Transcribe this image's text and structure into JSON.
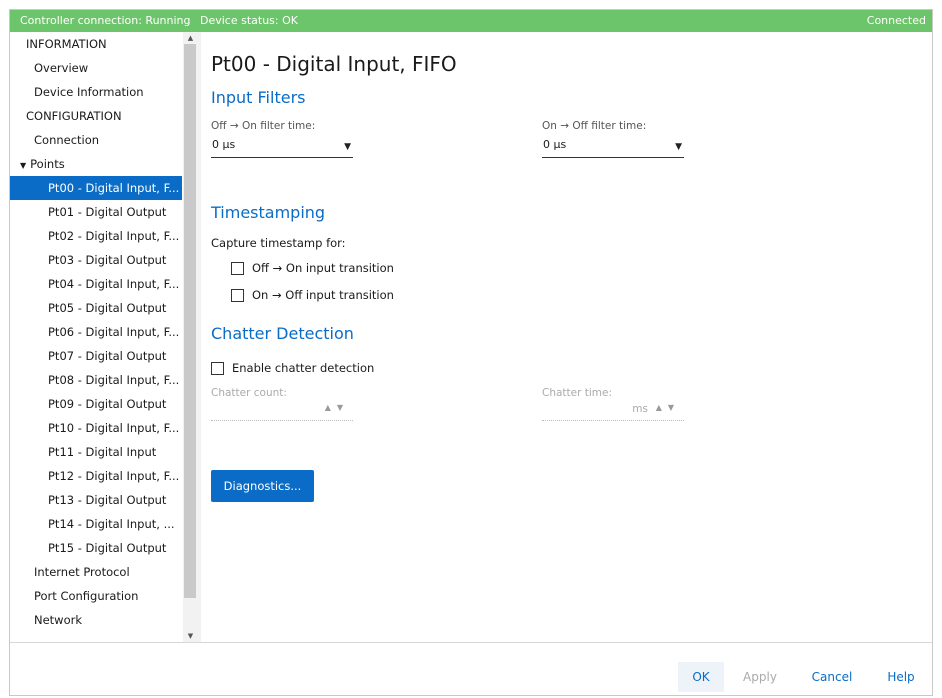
{
  "status_bar": {
    "controller": "Controller connection: Running",
    "device": "Device status: OK",
    "connection": "Connected"
  },
  "sidebar": {
    "items": [
      {
        "label": "INFORMATION",
        "selected": false
      },
      {
        "label": "Overview",
        "selected": false
      },
      {
        "label": "Device Information",
        "selected": false
      },
      {
        "label": "CONFIGURATION",
        "selected": false
      },
      {
        "label": "Connection",
        "selected": false
      },
      {
        "label": "Points",
        "selected": false,
        "expanded": true
      },
      {
        "label": "Pt00 - Digital Input, F...",
        "selected": true
      },
      {
        "label": "Pt01 - Digital Output",
        "selected": false
      },
      {
        "label": "Pt02 - Digital Input, F...",
        "selected": false
      },
      {
        "label": "Pt03 - Digital Output",
        "selected": false
      },
      {
        "label": "Pt04 - Digital Input, F...",
        "selected": false
      },
      {
        "label": "Pt05 - Digital Output",
        "selected": false
      },
      {
        "label": "Pt06 - Digital Input, F...",
        "selected": false
      },
      {
        "label": "Pt07 - Digital Output",
        "selected": false
      },
      {
        "label": "Pt08 - Digital Input, F...",
        "selected": false
      },
      {
        "label": "Pt09 - Digital Output",
        "selected": false
      },
      {
        "label": "Pt10 - Digital Input, F...",
        "selected": false
      },
      {
        "label": "Pt11 - Digital Input",
        "selected": false
      },
      {
        "label": "Pt12 - Digital Input, F...",
        "selected": false
      },
      {
        "label": "Pt13 - Digital Output",
        "selected": false
      },
      {
        "label": "Pt14 - Digital Input, ...",
        "selected": false
      },
      {
        "label": "Pt15 - Digital Output",
        "selected": false
      },
      {
        "label": "Internet Protocol",
        "selected": false
      },
      {
        "label": "Port Configuration",
        "selected": false
      },
      {
        "label": "Network",
        "selected": false
      }
    ]
  },
  "main": {
    "title": "Pt00 - Digital Input, FIFO",
    "input_filters": {
      "heading": "Input Filters",
      "off_on_label": "Off → On filter time:",
      "off_on_value": "0 µs",
      "on_off_label": "On → Off filter time:",
      "on_off_value": "0 µs"
    },
    "timestamping": {
      "heading": "Timestamping",
      "capture_label": "Capture timestamp for:",
      "off_on_transition": "Off → On input transition",
      "on_off_transition": "On → Off input transition"
    },
    "chatter": {
      "heading": "Chatter Detection",
      "enable_label": "Enable chatter detection",
      "count_label": "Chatter count:",
      "time_label": "Chatter time:",
      "time_unit": "ms"
    },
    "diagnostics_button": "Diagnostics..."
  },
  "footer": {
    "ok": "OK",
    "apply": "Apply",
    "cancel": "Cancel",
    "help": "Help"
  },
  "colors": {
    "status_bar": "#6dc56b",
    "accent": "#0a6cc7"
  }
}
